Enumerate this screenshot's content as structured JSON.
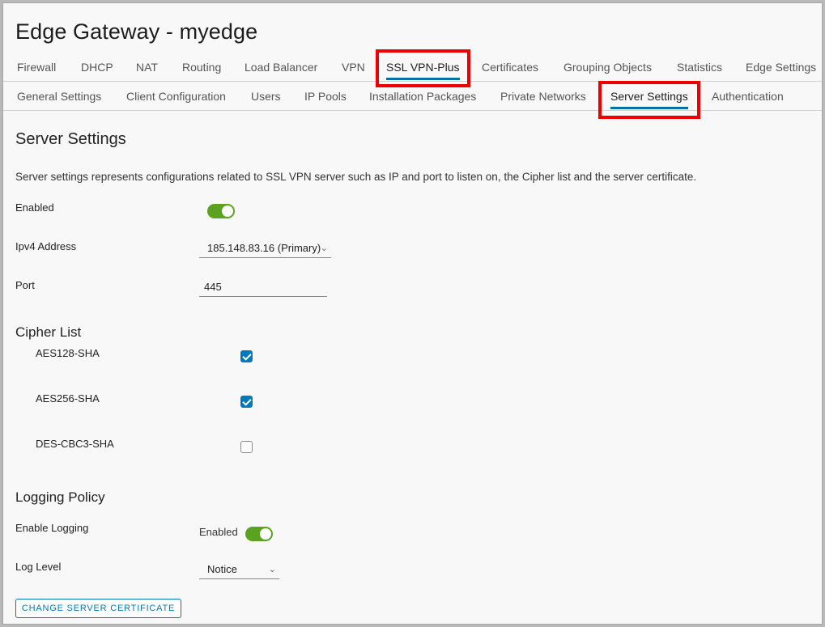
{
  "title": "Edge Gateway - myedge",
  "main_tabs": [
    {
      "label": "Firewall"
    },
    {
      "label": "DHCP"
    },
    {
      "label": "NAT"
    },
    {
      "label": "Routing"
    },
    {
      "label": "Load Balancer"
    },
    {
      "label": "VPN"
    },
    {
      "label": "SSL VPN-Plus",
      "active": true
    },
    {
      "label": "Certificates"
    },
    {
      "label": "Grouping Objects"
    },
    {
      "label": "Statistics"
    },
    {
      "label": "Edge Settings"
    }
  ],
  "sub_tabs": [
    {
      "label": "General Settings"
    },
    {
      "label": "Client Configuration"
    },
    {
      "label": "Users"
    },
    {
      "label": "IP Pools"
    },
    {
      "label": "Installation Packages"
    },
    {
      "label": "Private Networks"
    },
    {
      "label": "Server Settings",
      "active": true
    },
    {
      "label": "Authentication"
    }
  ],
  "section": {
    "title": "Server Settings",
    "description": "Server settings represents configurations related to SSL VPN server such as IP and port to listen on, the Cipher list and the server certificate."
  },
  "enabled": {
    "label": "Enabled",
    "value": true
  },
  "ipv4": {
    "label": "Ipv4 Address",
    "value": "185.148.83.16 (Primary)"
  },
  "port": {
    "label": "Port",
    "value": "445"
  },
  "cipher_list": {
    "title": "Cipher List",
    "items": [
      {
        "label": "AES128-SHA",
        "checked": true
      },
      {
        "label": "AES256-SHA",
        "checked": true
      },
      {
        "label": "DES-CBC3-SHA",
        "checked": false
      }
    ]
  },
  "logging": {
    "title": "Logging Policy",
    "enable_label": "Enable Logging",
    "enable_state_text": "Enabled",
    "enable_value": true,
    "level_label": "Log Level",
    "level_value": "Notice"
  },
  "change_cert_button": "CHANGE SERVER CERTIFICATE",
  "colors": {
    "accent": "#0079b8",
    "toggle_on": "#5aa220",
    "highlight_box": "#ee0000"
  }
}
